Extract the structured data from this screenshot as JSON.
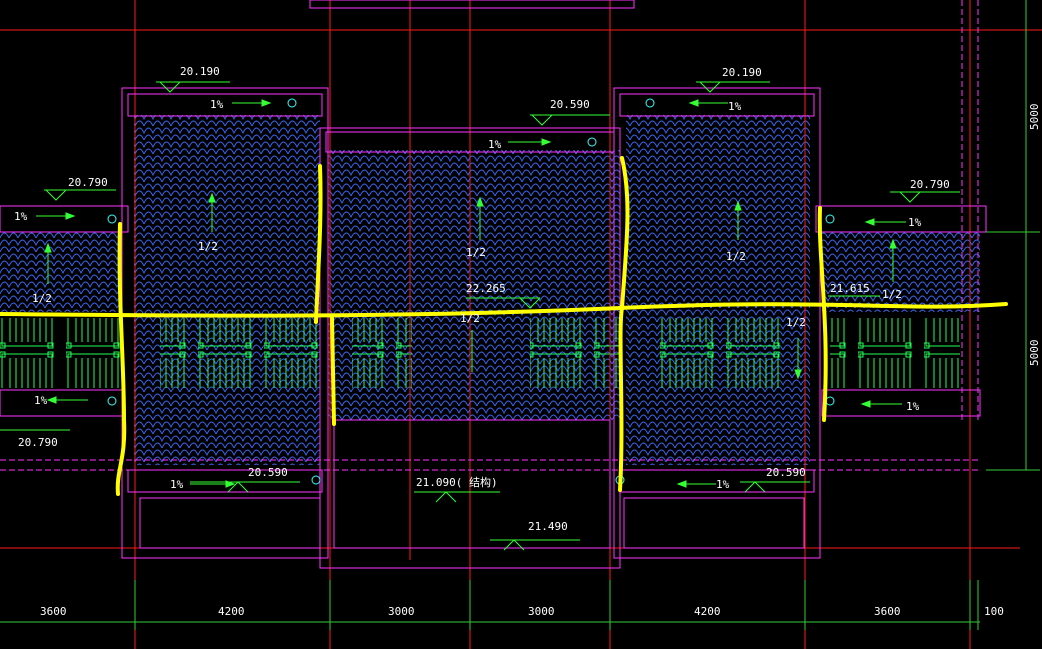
{
  "colors": {
    "background": "#000000",
    "axis_red": "#ff1a1a",
    "outline_magenta": "#ff33ff",
    "tile_blue": "#3366ff",
    "rail_green": "#22ff55",
    "annotation_green": "#33ff33",
    "text_white": "#ffffff",
    "highlight_yellow": "#ffff00",
    "dim_green": "#33cc33",
    "cyan": "#33ffff"
  },
  "elevations": {
    "left_wing_top": "20.190",
    "center_top": "20.590",
    "right_wing_top": "20.190",
    "left_end_top": "20.790",
    "right_end_top": "20.790",
    "left_end_bottom": "20.790",
    "ridge_mid": "22.265",
    "ridge_right": "21.615",
    "left_wing_bottom": "20.590",
    "right_wing_bottom": "20.590",
    "center_structure": "21.090(  结构)",
    "center_bottom": "21.490"
  },
  "slopes": {
    "gutter": "1%",
    "roof": "1/2"
  },
  "dimensions": {
    "right_top": "5000",
    "right_bottom": "5000",
    "bottom": [
      "3600",
      "4200",
      "3000",
      "3000",
      "4200",
      "3600",
      "100"
    ]
  }
}
